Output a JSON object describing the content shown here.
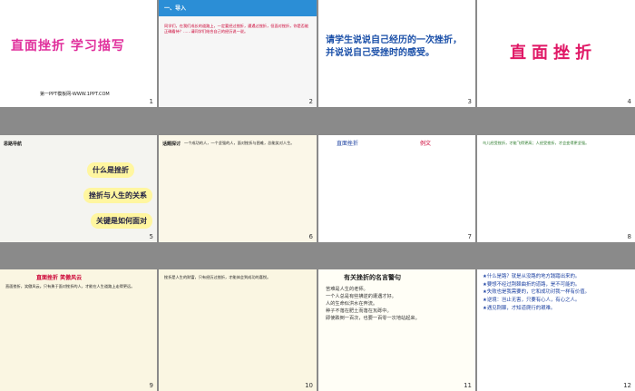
{
  "slides": [
    {
      "num": "1",
      "title": "直面挫折  学习描写",
      "footer": "第一PPT模板网-WWW.1PPT.COM"
    },
    {
      "num": "2",
      "heading": "一、导入",
      "text": "同学们，在我们成长的道路上，一定要经过挫折，遭遇过挫折，但面对挫折，你是否能正确看待？……请同学们结合自己的经历说一说。"
    },
    {
      "num": "3",
      "prompt": "请学生说说自己经历的一次挫折，并说说自己受挫时的感受。"
    },
    {
      "num": "4",
      "title": "直面挫折"
    },
    {
      "num": "5",
      "sidebar": "思路导航",
      "q1": "什么是挫折",
      "q2": "挫折与人生的关系",
      "q3": "关键是如何面对"
    },
    {
      "num": "6",
      "sidebar": "话题探讨",
      "text": "一个成功的人，一个坚强的人，面对挫折与困难，总能笑对人生。"
    },
    {
      "num": "7",
      "title": "直面挫折",
      "label": "例文"
    },
    {
      "num": "8",
      "text": "鸟儿经受挫折，才能飞得更高；人经受挫折，才会变得更坚强。"
    },
    {
      "num": "9",
      "title": "直面挫折  笑傲风云",
      "text": "直面挫折，笑傲风云。只有勇于面对挫折的人，才能在人生道路上走得更远。"
    },
    {
      "num": "10",
      "text": "挫折是人生的财富，只有经历过挫折，才能体会到成功的喜悦。"
    },
    {
      "num": "11",
      "title": "有关挫折的名言警句",
      "quotes": [
        "苦难是人生的老师。",
        "一个人总是有些拂逆的遭遇才好。",
        "人的生命似洪水在奔流。",
        "种子不落在肥土而落在瓦砾中。",
        "即使跌倒一百次，也要一百零一次地站起来。"
      ]
    },
    {
      "num": "12",
      "quotes": [
        "★什么是路？就是从没路的地方践踏出来的。",
        "★要想不经过荆棘曲折的道路，是不可能的。",
        "★失败也是我需要的，它和成功对我一样有价值。",
        "★逆境：岂止无害，只要有心人，有心之人。",
        "★遇见荆棘，才知道爬行的艰难。"
      ]
    }
  ]
}
